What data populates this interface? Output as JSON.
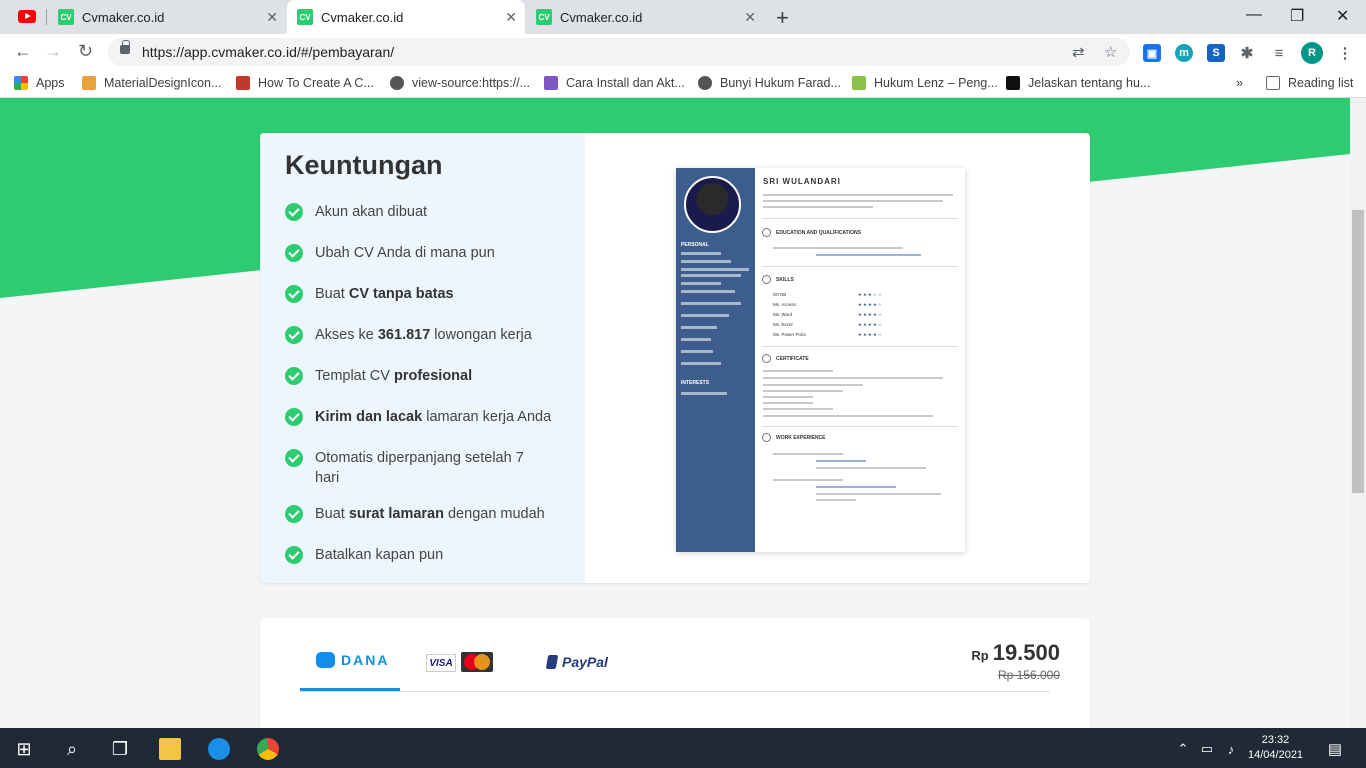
{
  "browser": {
    "tabs": [
      {
        "title": "Cvmaker.co.id",
        "favicon": "CV"
      },
      {
        "title": "Cvmaker.co.id",
        "favicon": "CV"
      },
      {
        "title": "Cvmaker.co.id",
        "favicon": "CV"
      }
    ],
    "url": "https://app.cvmaker.co.id/#/pembayaran/",
    "profile_initial": "R",
    "bookmarks": [
      "Apps",
      "MaterialDesignIcon...",
      "How To Create A C...",
      "view-source:https://...",
      "Cara Install dan Akt...",
      "Bunyi Hukum Farad...",
      "Hukum Lenz – Peng...",
      "Jelaskan tentang hu..."
    ],
    "overflow": "»",
    "reading_list": "Reading list"
  },
  "benefits": {
    "title": "Keuntungan",
    "items": [
      {
        "pre": "Akun akan dibuat",
        "bold": "",
        "post": ""
      },
      {
        "pre": "Ubah CV Anda di mana pun",
        "bold": "",
        "post": ""
      },
      {
        "pre": "Buat ",
        "bold": "CV tanpa batas",
        "post": ""
      },
      {
        "pre": "Akses ke ",
        "bold": "361.817",
        "post": " lowongan kerja"
      },
      {
        "pre": "Templat CV ",
        "bold": "profesional",
        "post": ""
      },
      {
        "pre": "",
        "bold": "Kirim dan lacak",
        "post": " lamaran kerja Anda"
      },
      {
        "pre": "Otomatis diperpanjang setelah 7 hari",
        "bold": "",
        "post": ""
      },
      {
        "pre": "Buat ",
        "bold": "surat lamaran",
        "post": " dengan mudah"
      },
      {
        "pre": "Batalkan kapan pun",
        "bold": "",
        "post": ""
      }
    ]
  },
  "cv_preview": {
    "name": "SRI WULANDARI",
    "side_personal": "PERSONAL",
    "side_interests": "INTERESTS",
    "sections": [
      "EDUCATION AND QUALIFICATIONS",
      "SKILLS",
      "CERTIFICATE",
      "WORK EXPERIENCE"
    ],
    "skills": [
      {
        "name": "MYOB",
        "stars": "★★★☆☆"
      },
      {
        "name": "Ms. Access",
        "stars": "★★★★☆"
      },
      {
        "name": "Ms. Word",
        "stars": "★★★★☆"
      },
      {
        "name": "Ms. Excel",
        "stars": "★★★★☆"
      },
      {
        "name": "Ms. Power Point",
        "stars": "★★★★☆"
      }
    ]
  },
  "payment": {
    "methods": [
      "DANA",
      "VISA",
      "PayPal"
    ],
    "price_currency": "Rp",
    "price_value": "19.500",
    "old_price": "Rp 156.000"
  },
  "taskbar": {
    "time": "23:32",
    "date": "14/04/2021"
  },
  "colors": {
    "brand_green": "#2ecc71",
    "dana_blue": "#118ee9",
    "cv_sidebar": "#3d5e8c"
  }
}
